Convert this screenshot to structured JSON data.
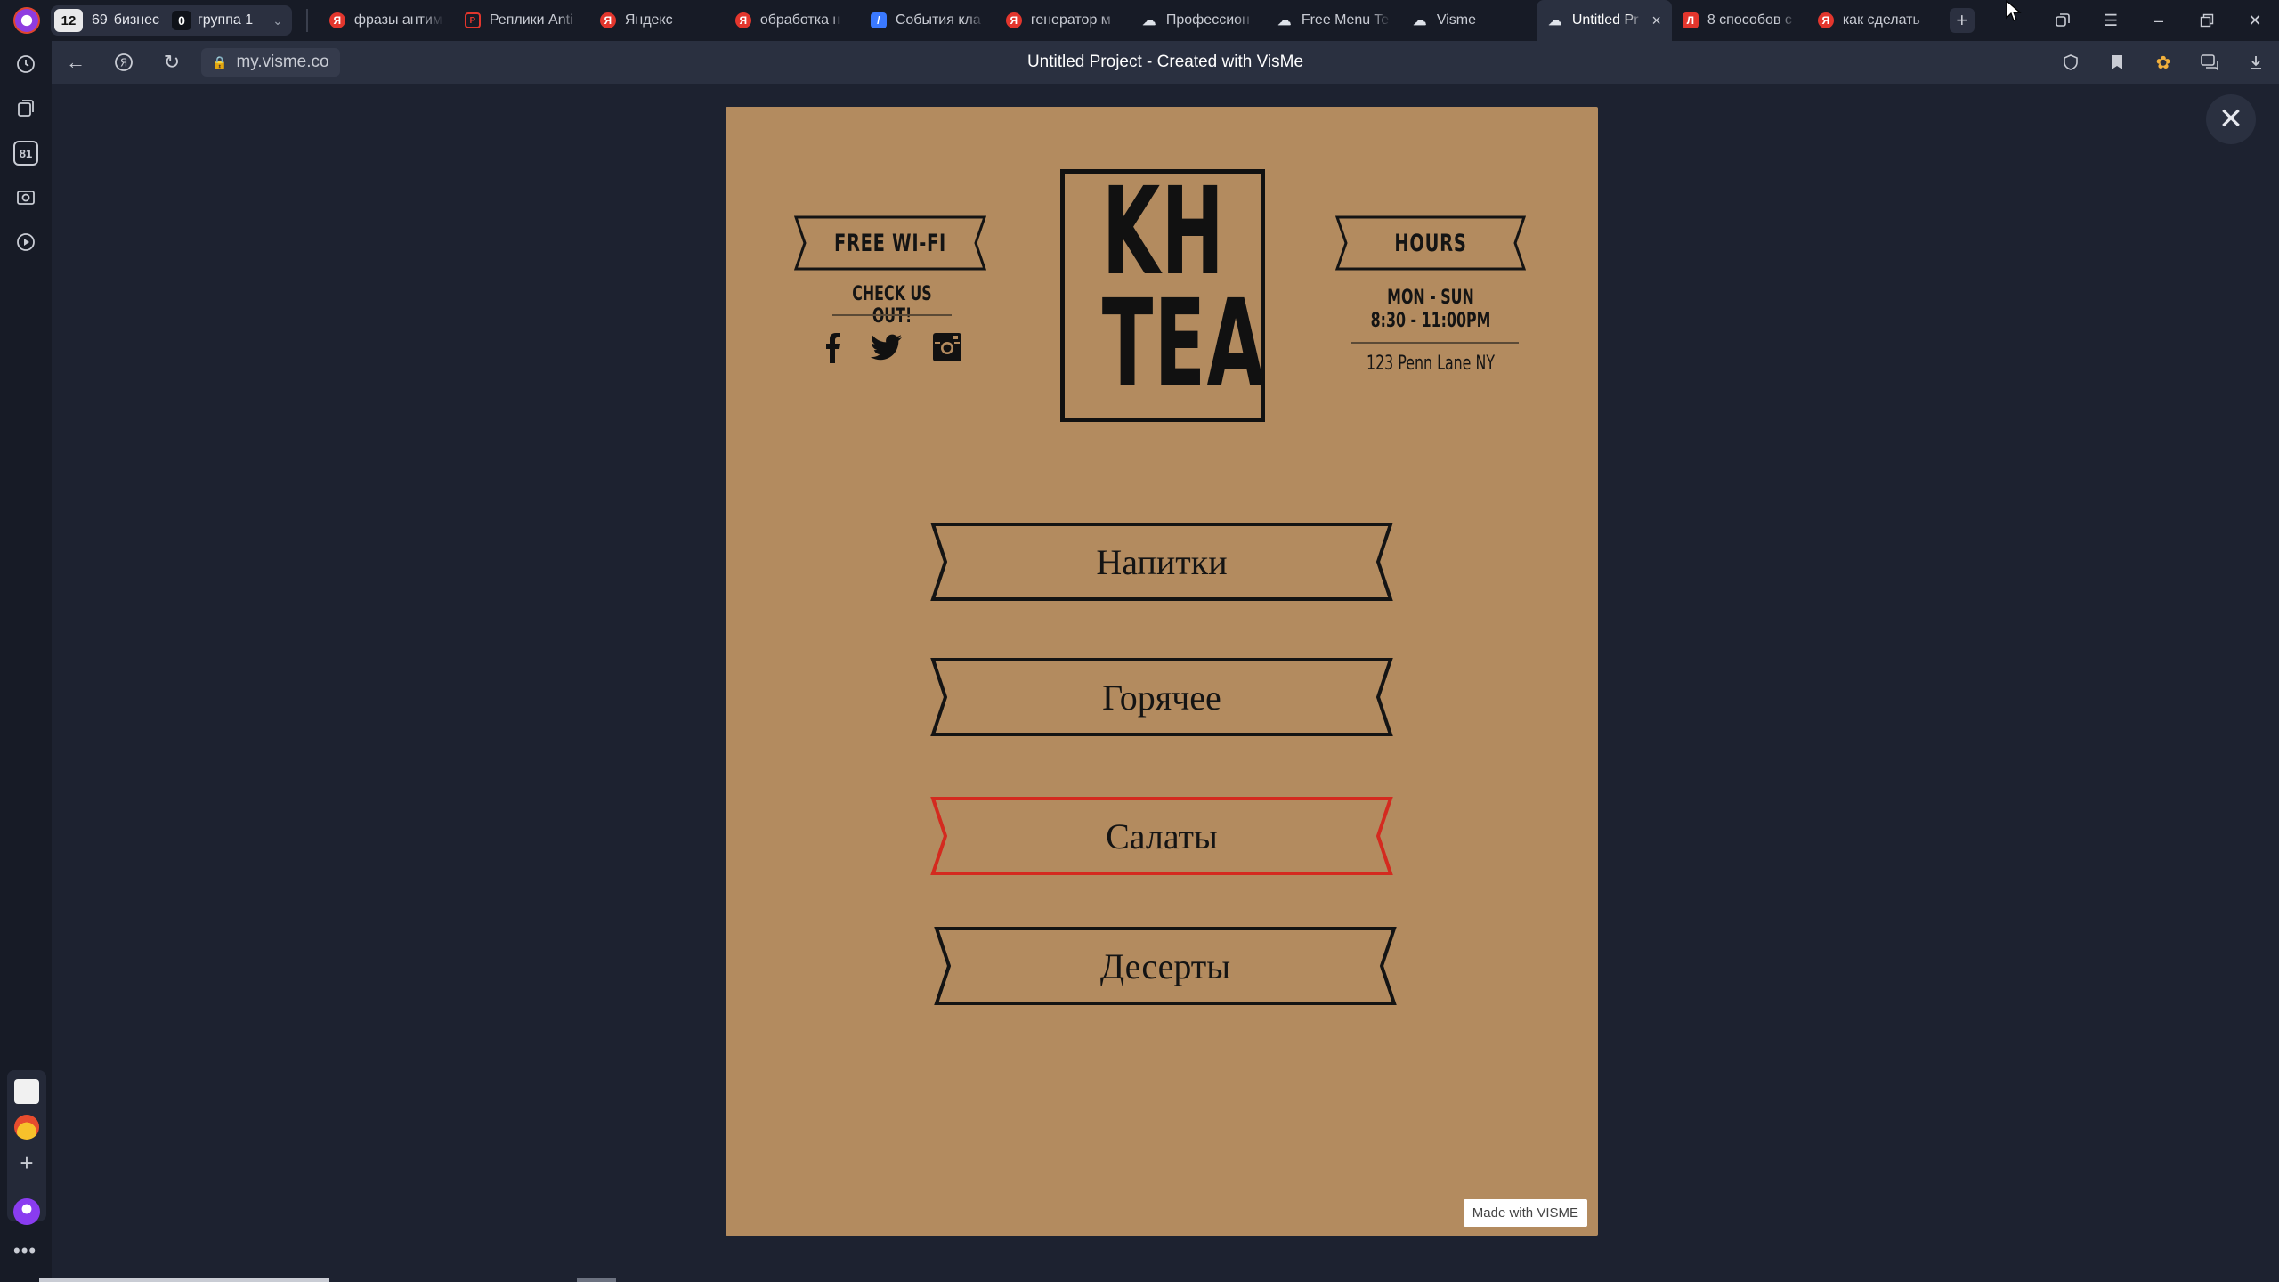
{
  "browser": {
    "tab_count": "12",
    "group": {
      "business_count": "69",
      "business_label": "бизнес",
      "group_count": "0",
      "group_label": "группа 1"
    },
    "tabs": [
      {
        "label": "фразы антим",
        "favicon": "yandex-icon"
      },
      {
        "label": "Реплики Anti",
        "favicon": "pdf-icon"
      },
      {
        "label": "Яндекс",
        "favicon": "yandex-icon"
      },
      {
        "label": "обработка н",
        "favicon": "yandex-icon"
      },
      {
        "label": "События кла",
        "favicon": "slash-icon"
      },
      {
        "label": "генератор м",
        "favicon": "yandex-icon"
      },
      {
        "label": "Профессион",
        "favicon": "visme-icon"
      },
      {
        "label": "Free Menu Te",
        "favicon": "visme-icon"
      },
      {
        "label": "Visme",
        "favicon": "visme-icon"
      },
      {
        "label": "Untitled Pr",
        "favicon": "visme-icon",
        "active": true
      },
      {
        "label": "8 способов с",
        "favicon": "l-icon"
      },
      {
        "label": "как сделать",
        "favicon": "yandex-icon"
      }
    ],
    "url": "my.visme.co",
    "page_title": "Untitled Project - Created with VisMe",
    "sidebar_badge": "81"
  },
  "menu": {
    "wifi_label": "FREE WI-FI",
    "check_us": "CHECK US OUT!",
    "logo_line1": "KH",
    "logo_line2": "TEA",
    "hours_label": "HOURS",
    "days": "MON - SUN",
    "time": "8:30 - 11:00PM",
    "address": "123 Penn Lane NY",
    "categories": [
      {
        "label": "Напитки",
        "border_color": "#141414"
      },
      {
        "label": "Горячее",
        "border_color": "#141414"
      },
      {
        "label": "Салаты",
        "border_color": "#d42a1f"
      },
      {
        "label": "Десерты",
        "border_color": "#141414"
      }
    ],
    "badge": "Made with VISME",
    "background_color": "#b38b5f"
  }
}
